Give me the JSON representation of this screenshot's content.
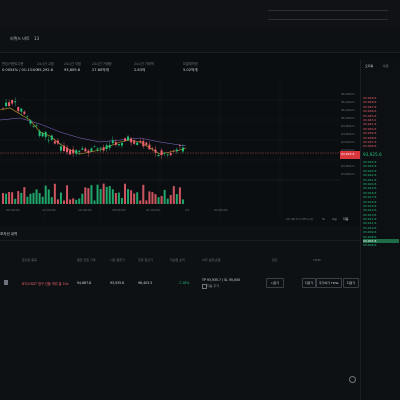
{
  "tabs": [
    {
      "label": "리퀴드 비트"
    },
    {
      "label": "13"
    }
  ],
  "stats": [
    {
      "label": "펀딩/카운트다운",
      "value": "0.0054% / 01:13:00"
    },
    {
      "label": "24시간 고점",
      "value": "95,292.6"
    },
    {
      "label": "24시간 저점",
      "value": "93,609.8"
    },
    {
      "label": "24시간 거래량",
      "value": "27.60억개"
    },
    {
      "label": "24시간 거래액",
      "value": "2.63억"
    },
    {
      "label": "미결제약정",
      "value": "5.02억개"
    }
  ],
  "chart": {
    "price_tag": "93,925.6",
    "price_tag_sub": "00:00",
    "scale_labels": [
      "95,600.0",
      "95,400.0",
      "95,200.0",
      "95,000.0",
      "94,800.0",
      "94,600.0",
      "94,400.0",
      "94,200.0",
      "94,000.0",
      "93,800.0",
      "93,600.0",
      "93,400.0"
    ],
    "time_labels": [
      "09:00:00",
      "12:00:00",
      "15:00:00",
      "18:00:00",
      "21:00:00",
      "24",
      "03:00:00"
    ],
    "toolbar_labels": [
      "표준",
      "트레이딩뷰",
      "심도"
    ],
    "footer_time": "20:46:13 (UTC+9)",
    "footer_btns": [
      "%",
      "log",
      "자동"
    ]
  },
  "orderbook": {
    "tabs": [
      "오더북",
      "체결"
    ],
    "sells": [
      "93,949.6",
      "93,948.6",
      "93,947.6",
      "93,946.6",
      "93,945.6",
      "93,943.2",
      "93,941.6",
      "93,940.6",
      "93,939.6",
      "93,938.6",
      "93,937.6",
      "93,936.6",
      "93,935.6",
      "93,934.6"
    ],
    "mid_price": "93,925.6",
    "buys": [
      "93,925.6",
      "93,924.6",
      "93,923.6",
      "93,922.6",
      "93,921.6",
      "93,920.6",
      "93,919.6",
      "93,918.6",
      "93,917.6",
      "93,916.6",
      "93,915.6",
      "93,914.6",
      "93,913.6",
      "93,912.6",
      "93,911.6",
      "93,910.6",
      "93,909.6",
      "93,908.6",
      "93,907.6",
      "93,906.6"
    ]
  },
  "positions": {
    "title": "포지션 내역",
    "headers": [
      "포지션 종목",
      "평균 진입 가격",
      "시장 평균가",
      "추정 청산가",
      "미실현 손익",
      "이익 실현/손절",
      "청산",
      "TP/SL"
    ],
    "row": {
      "symbol": "BTCUSDT 영구 선물 격리 롱 10x",
      "entry": "94,687.8",
      "mark": "93,935.6",
      "liq": "96,403.3",
      "pnl": "-7.18%",
      "tpsl_text": "TP 93,935.7 / SL 95,000",
      "checkbox_label": "자동 추가",
      "btn_market": "시장가",
      "btn_limit": "지정가",
      "btn_tpsl": "추가하기 TP/SL",
      "btn_close": "지정가"
    }
  }
}
